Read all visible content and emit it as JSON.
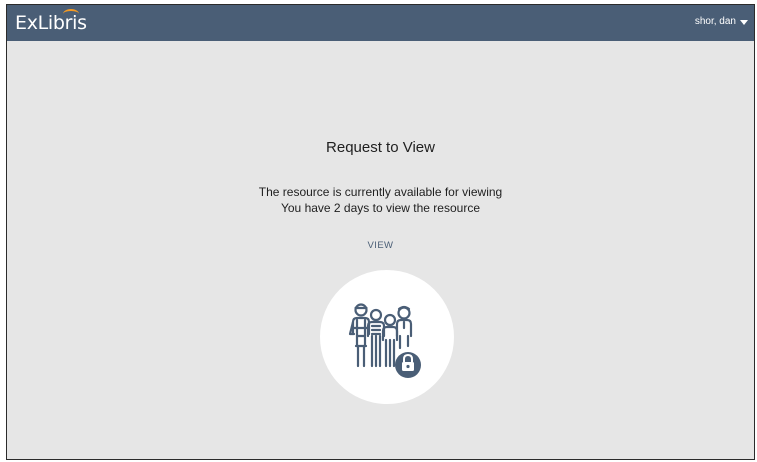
{
  "header": {
    "logo_text": "ExLibris",
    "user_name": "shor, dan"
  },
  "request": {
    "title": "Request to View",
    "line1": "The resource is currently available for viewing",
    "line2": "You have 2 days to view the resource",
    "view_label": "VIEW"
  },
  "colors": {
    "topbar": "#4a5e76",
    "logo_accent": "#f39a24",
    "background": "#e6e6e6",
    "illustration": "#4a5e76"
  },
  "icons": {
    "user_menu": "chevron-down-icon",
    "illustration": "people-group-icon",
    "lock": "lock-icon"
  }
}
